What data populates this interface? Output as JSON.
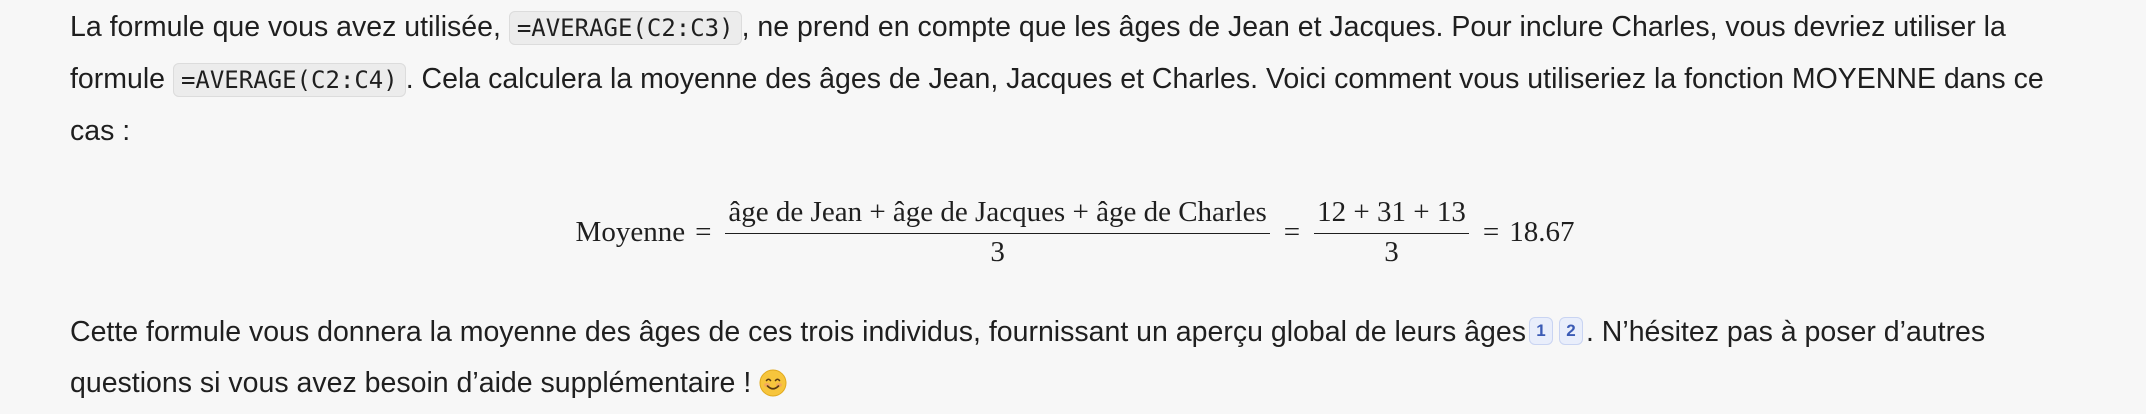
{
  "paragraph1": {
    "t1": "La formule que vous avez utilisée, ",
    "code1": "=AVERAGE(C2:C3)",
    "t2": ", ne prend en compte que les âges de Jean et Jacques. Pour inclure Charles, vous devriez utiliser la formule ",
    "code2": "=AVERAGE(C2:C4)",
    "t3": ". Cela calculera la moyenne des âges de Jean, Jacques et Charles. Voici comment vous utiliseriez la fonction MOYENNE dans ce cas :"
  },
  "equation": {
    "lhs": "Moyenne",
    "eq": "=",
    "frac1_num": "âge de Jean + âge de Jacques + âge de Charles",
    "frac1_den": "3",
    "frac2_num": "12 + 31 + 13",
    "frac2_den": "3",
    "result": "18.67"
  },
  "paragraph2": {
    "t1": "Cette formule vous donnera la moyenne des âges de ces trois individus, fournissant un aperçu global de leurs âges",
    "cite1": "1",
    "cite2": "2",
    "t2": ". N’hésitez pas à poser d’autres questions si vous avez besoin d’aide supplémentaire ! ",
    "emoji": "smiling-face-emoji"
  }
}
